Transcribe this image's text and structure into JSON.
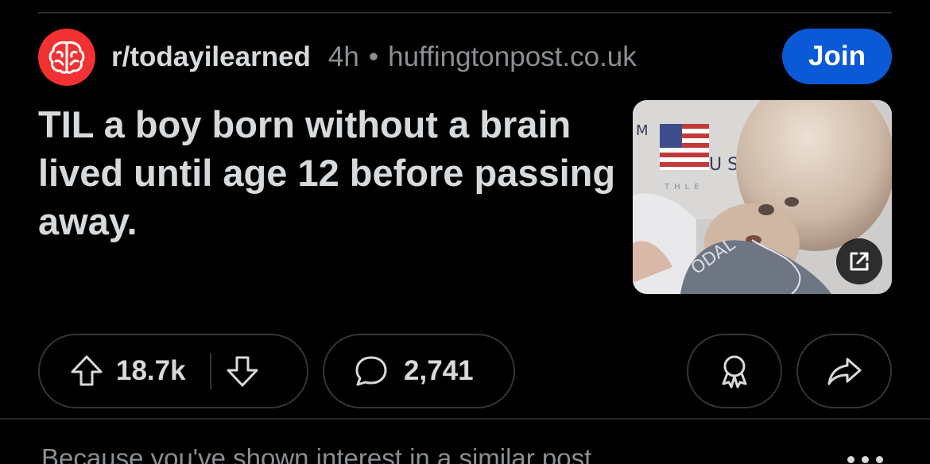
{
  "post": {
    "subreddit": "r/todayilearned",
    "age": "4h",
    "separator": "•",
    "domain": "huffingtonpost.co.uk",
    "title": "TIL a boy born without a brain lived until age 12 before passing away.",
    "join_label": "Join",
    "thumbnail_icon": "open-external-icon"
  },
  "actions": {
    "upvotes": "18.7k",
    "comments": "2,741",
    "icons": [
      "upvote-icon",
      "downvote-icon",
      "comment-icon",
      "award-icon",
      "share-icon"
    ]
  },
  "next_item": {
    "reason_text": "Because you've shown interest in a similar post"
  },
  "colors": {
    "background": "#000000",
    "subreddit_icon": "#f23232",
    "join_button": "#0a5ad7",
    "text_primary": "#d7dadc",
    "text_muted": "#8a8f93",
    "border": "#343536"
  }
}
